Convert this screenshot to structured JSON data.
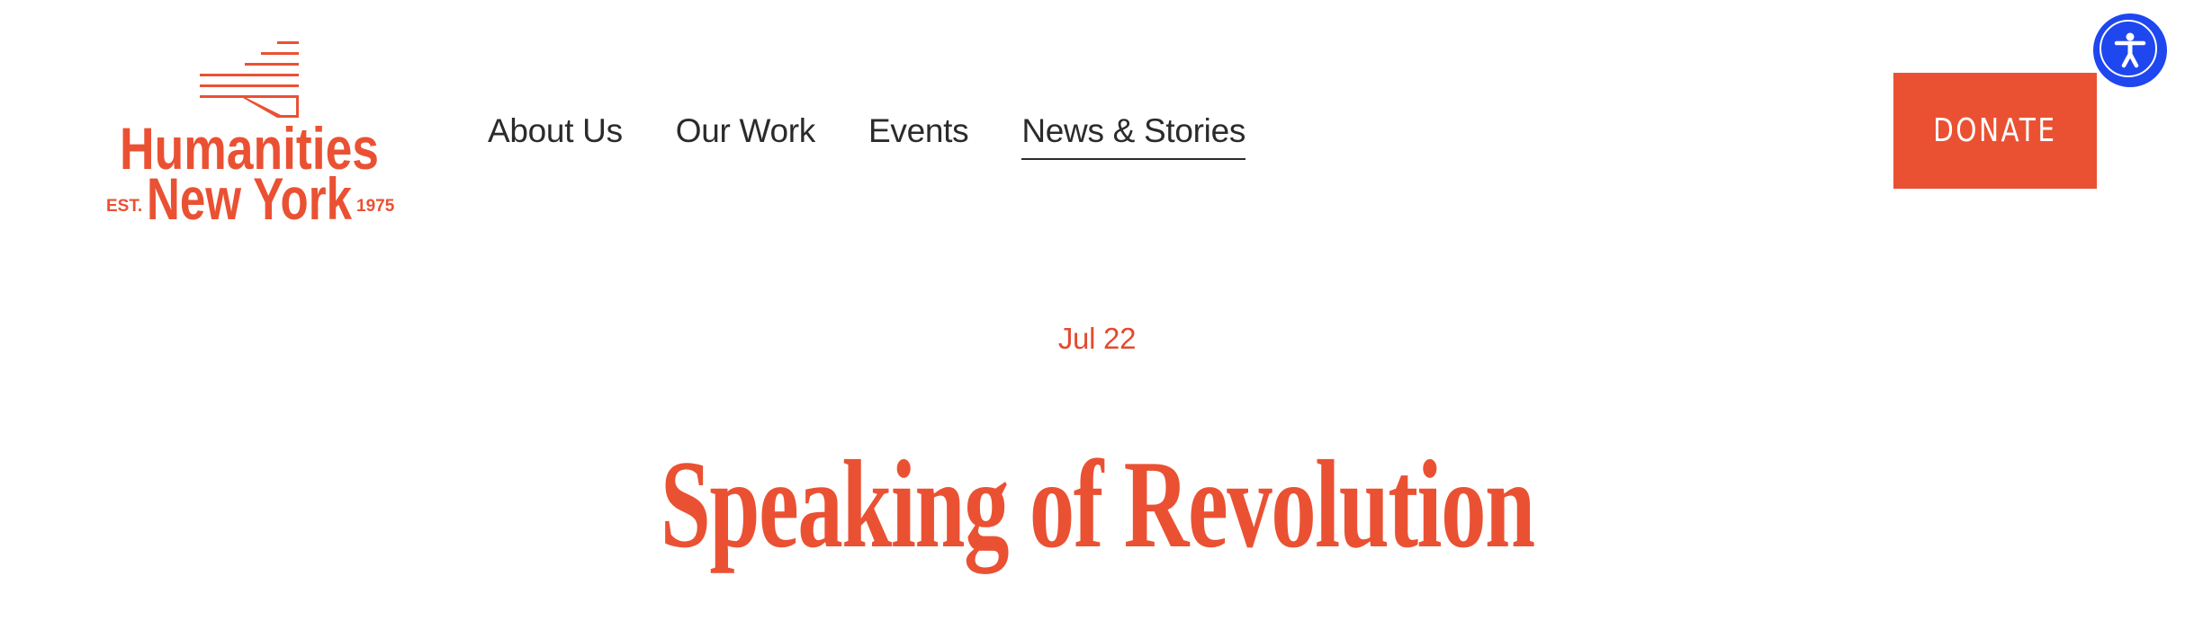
{
  "brand": {
    "name_line1": "Humanities",
    "name_line2": "New York",
    "est_label": "EST.",
    "year": "1975",
    "color": "#ea5133"
  },
  "nav": {
    "items": [
      {
        "label": "About Us",
        "active": false
      },
      {
        "label": "Our Work",
        "active": false
      },
      {
        "label": "Events",
        "active": false
      },
      {
        "label": "News & Stories",
        "active": true
      }
    ]
  },
  "donate": {
    "label": "DONATE",
    "color": "#ea5133"
  },
  "accessibility": {
    "icon": "accessibility-icon",
    "color": "#1e47ef"
  },
  "article": {
    "date": "Jul 22",
    "title": "Speaking of Revolution",
    "accent_color": "#ea5133"
  }
}
